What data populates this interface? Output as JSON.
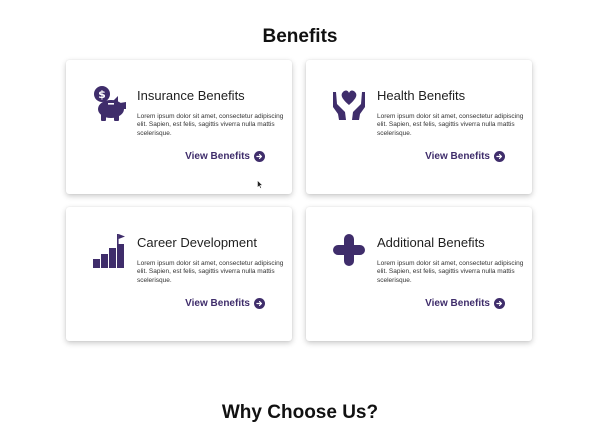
{
  "section": {
    "title": "Benefits"
  },
  "cards": [
    {
      "title": "Insurance Benefits",
      "icon": "piggy-bank-icon",
      "description": "Lorem ipsum dolor sit amet, consectetur adipiscing elit. Sapien, est felis, sagittis viverra nulla mattis scelerisque.",
      "link_label": "View Benefits"
    },
    {
      "title": "Health Benefits",
      "icon": "hands-heart-icon",
      "description": "Lorem ipsum dolor sit amet, consectetur adipiscing elit. Sapien, est felis, sagittis viverra nulla mattis scelerisque.",
      "link_label": "View Benefits"
    },
    {
      "title": "Career Development",
      "icon": "career-growth-icon",
      "description": "Lorem ipsum dolor sit amet, consectetur adipiscing elit. Sapien, est felis, sagittis viverra nulla mattis scelerisque.",
      "link_label": "View Benefits"
    },
    {
      "title": "Additional Benefits",
      "icon": "plus-icon",
      "description": "Lorem ipsum dolor sit amet, consectetur adipiscing elit. Sapien, est felis, sagittis viverra nulla mattis scelerisque.",
      "link_label": "View Benefits"
    }
  ],
  "next_section": {
    "title": "Why Choose Us?"
  },
  "colors": {
    "accent": "#3f2d6b",
    "card_background": "#ffffff",
    "page_background": "#ffffff"
  }
}
